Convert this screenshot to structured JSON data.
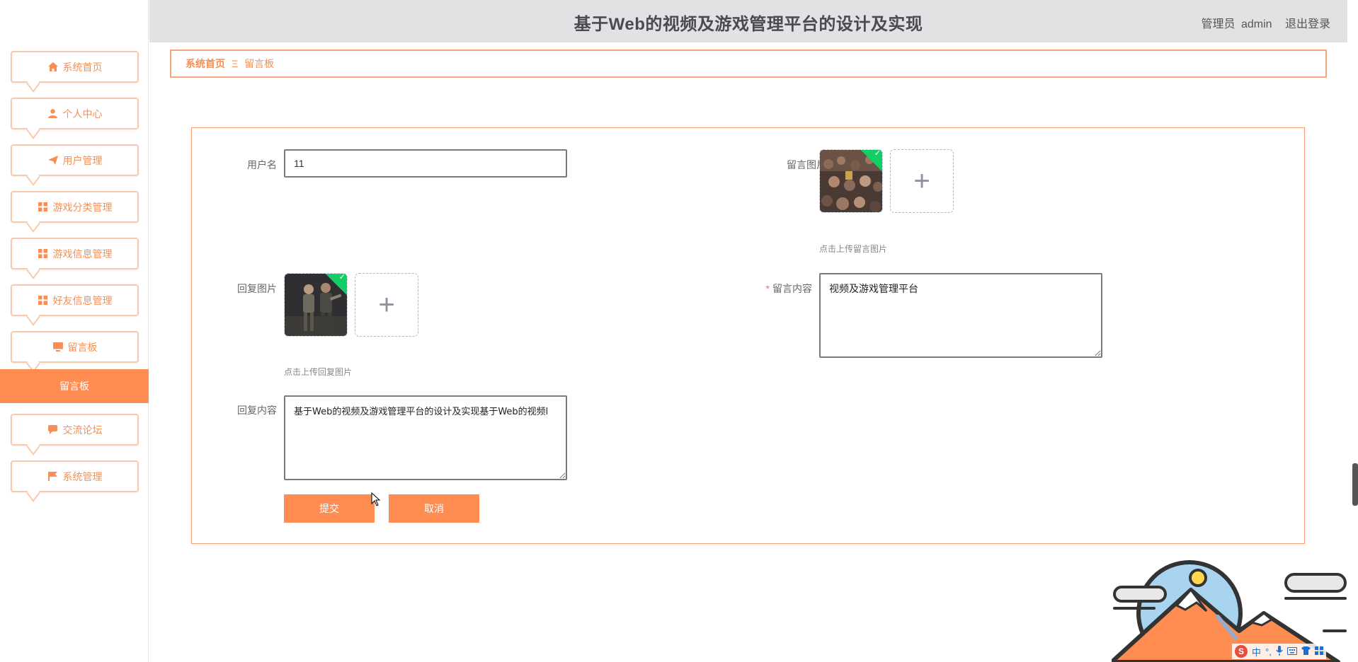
{
  "header": {
    "title": "基于Web的视频及游戏管理平台的设计及实现",
    "role": "管理员",
    "username": "admin",
    "logout": "退出登录"
  },
  "sidebar": {
    "items": [
      {
        "label": "系统首页",
        "icon": "home-icon"
      },
      {
        "label": "个人中心",
        "icon": "user-icon"
      },
      {
        "label": "用户管理",
        "icon": "paper-plane-icon"
      },
      {
        "label": "游戏分类管理",
        "icon": "grid-icon"
      },
      {
        "label": "游戏信息管理",
        "icon": "grid-icon"
      },
      {
        "label": "好友信息管理",
        "icon": "grid-icon"
      },
      {
        "label": "留言板",
        "icon": "monitor-icon"
      },
      {
        "label": "交流论坛",
        "icon": "chat-icon"
      },
      {
        "label": "系统管理",
        "icon": "flag-icon"
      }
    ],
    "active_sub": "留言板"
  },
  "breadcrumb": {
    "home": "系统首页",
    "separator": "Ξ",
    "current": "留言板"
  },
  "form": {
    "username_label": "用户名",
    "username_value": "11",
    "message_image_label": "留言图片",
    "message_image_tip": "点击上传留言图片",
    "reply_image_label": "回复图片",
    "reply_image_tip": "点击上传回复图片",
    "message_content_label": "留言内容",
    "message_content_value": "视频及游戏管理平台",
    "reply_content_label": "回复内容",
    "reply_content_value": "基于Web的视频及游戏管理平台的设计及实现基于Web的视频l",
    "submit": "提交",
    "cancel": "取消",
    "upload_plus": "+"
  },
  "ime": {
    "logo": "S",
    "mode": "中"
  },
  "colors": {
    "accent": "#ff8c50",
    "accent_text": "#f58f55",
    "header_bg": "#e2e2e4",
    "upload_success": "#13ce66"
  }
}
